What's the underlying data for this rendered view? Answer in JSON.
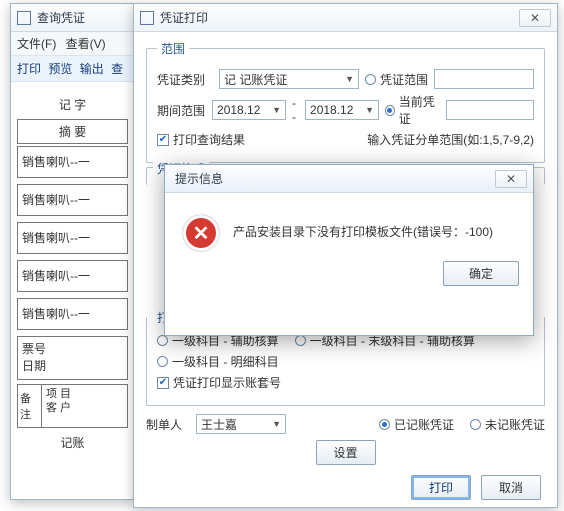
{
  "w1": {
    "title": "查询凭证",
    "menu": {
      "file": "文件(F)",
      "view": "查看(V)"
    },
    "toolbar": {
      "print": "打印",
      "preview": "预览",
      "export": "输出",
      "more": "查"
    },
    "hdr1": "记   字",
    "hdr2": "摘  要",
    "rows": [
      "销售喇叭--一",
      "销售喇叭--一",
      "销售喇叭--一",
      "销售喇叭--一",
      "销售喇叭--一"
    ],
    "b1": "票号",
    "b2": "日期",
    "remark_label": "备注",
    "remark_lines": [
      "项  目",
      "客  户"
    ],
    "footer": "记账"
  },
  "w2": {
    "title": "凭证打印",
    "range_legend": "范围",
    "type_label": "凭证类别",
    "type_value": "记 记账凭证",
    "period_label": "期间范围",
    "period_from": "2018.12",
    "period_to": "2018.12",
    "radio_range": "凭证范围",
    "radio_current": "当前凭证",
    "chk_print_query": "打印查询结果",
    "range_hint": "输入凭证分单范围(如:1,5,7-9,2)",
    "fmt_legend": "凭证格式",
    "sec2_cut": "打",
    "opt_aux1": "一级科目 - 辅助核算",
    "opt_aux2": "一级科目 - 末级科目 - 辅助核算",
    "opt_detail": "一级科目 - 明细科目",
    "chk_show_book": "凭证打印显示账套号",
    "maker_label": "制单人",
    "maker_value": "王士嘉",
    "radio_posted": "已记账凭证",
    "radio_unposted": "未记账凭证",
    "btn_settings": "设置",
    "btn_print": "打印",
    "btn_cancel": "取消"
  },
  "dlg": {
    "title": "提示信息",
    "msg": "产品安装目录下没有打印模板文件(错误号：-100)",
    "ok": "确定"
  }
}
